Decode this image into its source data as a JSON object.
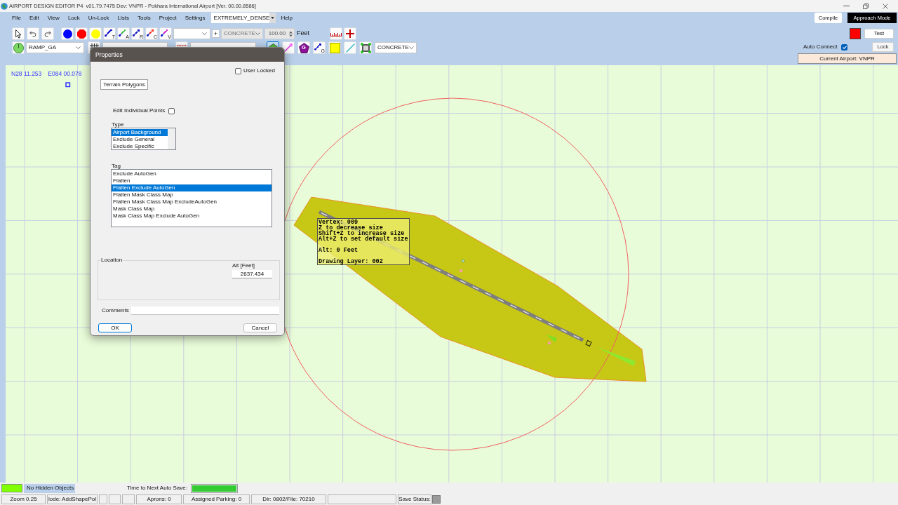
{
  "window": {
    "title": "AIRPORT DESIGN EDITOR P4  v01.79.7475 Dev: VNPR - Pokhara International Airport [Ver. 00.00.8586]"
  },
  "menu": [
    {
      "kind": "item",
      "label": "File"
    },
    {
      "kind": "item",
      "label": "Edit"
    },
    {
      "kind": "item",
      "label": "View"
    },
    {
      "kind": "item",
      "label": "Lock"
    },
    {
      "kind": "item",
      "label": "Un-Lock"
    },
    {
      "kind": "item",
      "label": "Lists"
    },
    {
      "kind": "item",
      "label": "Tools"
    },
    {
      "kind": "item",
      "label": "Project"
    },
    {
      "kind": "item",
      "label": "Settings"
    },
    {
      "kind": "select",
      "value": "EXTREMELY_DENSE"
    },
    {
      "kind": "item",
      "label": "Help"
    }
  ],
  "toolbar_rows": [
    {
      "groups": [
        [
          {
            "kind": "pointer",
            "selected": false
          },
          {
            "kind": "undo",
            "selected": false
          },
          {
            "kind": "redo",
            "selected": false
          }
        ],
        [
          {
            "kind": "dot",
            "color": "#0000ff",
            "selected": false
          },
          {
            "kind": "octagon",
            "color": "#ff0000",
            "selected": false
          },
          {
            "kind": "dot",
            "color": "#ffff00",
            "selected": false
          },
          {
            "kind": "line",
            "letter": "T",
            "color": "#1414c8",
            "selected": false
          },
          {
            "kind": "line",
            "letter": "A",
            "color": "#40c040",
            "selected": false
          },
          {
            "kind": "line",
            "letter": "R",
            "color": "#1414c8",
            "selected": false
          },
          {
            "kind": "line",
            "letter": "C",
            "color": "#ff3020",
            "selected": false
          },
          {
            "kind": "line",
            "letter": "V",
            "color": "#d030d0",
            "selected": false
          },
          {
            "kind": "select",
            "disabled": false
          },
          {
            "kind": "button",
            "label": "+"
          },
          {
            "kind": "select",
            "value": "CONCRETE",
            "disabled": true
          },
          {
            "kind": "spin",
            "value": "100.00",
            "disabled": true
          },
          {
            "kind": "label",
            "text": "Feet"
          }
        ],
        [
          {
            "kind": "ruler",
            "selected": false
          },
          {
            "kind": "cross",
            "selected": false
          }
        ]
      ]
    },
    {
      "groups": [
        [
          {
            "kind": "clock",
            "selected": false
          },
          {
            "kind": "select",
            "value": "RAMP_GA",
            "disabled": false
          }
        ],
        [
          {
            "kind": "grid",
            "selected": false
          },
          {
            "kind": "select",
            "disabled": false
          }
        ],
        [
          {
            "kind": "dots",
            "selected": false
          },
          {
            "kind": "select",
            "disabled": false
          }
        ],
        [
          {
            "kind": "house",
            "selected": true
          },
          {
            "kind": "wand",
            "selected": false
          },
          {
            "kind": "pentagon",
            "letter": "G",
            "selected": false
          },
          {
            "kind": "line",
            "letter": "G",
            "color": "#1414c8",
            "selected": false
          },
          {
            "kind": "square",
            "selected": false
          },
          {
            "kind": "diagonal",
            "selected": false
          },
          {
            "kind": "nodes",
            "selected": false
          },
          {
            "kind": "select",
            "value": "CONCRETE",
            "disabled": false
          }
        ]
      ]
    }
  ],
  "right_panel": {
    "header_buttons": [
      {
        "label": "Compile",
        "kind": "plain"
      },
      {
        "label": "Approach Mode",
        "kind": "dark"
      }
    ],
    "color_swatch": {
      "color": "#ff0000"
    },
    "test_button": "Test",
    "auto_connect": {
      "label": "Auto Connect",
      "checked": true
    },
    "lock_button": "Lock",
    "current_airport": "Current Airport: VNPR"
  },
  "canvas": {
    "coordinates": [
      "N28 11.253",
      "E084 00.078"
    ],
    "tooltip": {
      "blocks": [
        [
          "Vertex: 009",
          "Z to decrease size",
          "Shift+Z to increase size",
          "Alt+Z to set default size"
        ],
        [
          "Alt: 0 Feet"
        ],
        [
          "Drawing Layer: 002"
        ]
      ]
    }
  },
  "dialog": {
    "title": "Properties",
    "user_locked": {
      "label": "User Locked",
      "checked": false
    },
    "object_type": "Terrain Polygons",
    "edit_points": {
      "label": "Edit Individual Points",
      "checked": false
    },
    "type": {
      "label": "Type",
      "items": [
        {
          "label": "Airport Background",
          "selected": true
        },
        {
          "label": "Exclude General",
          "selected": false
        },
        {
          "label": "Exclude Specific",
          "selected": false
        }
      ]
    },
    "tag": {
      "label": "Tag",
      "items": [
        {
          "label": "Exclude AutoGen",
          "selected": false
        },
        {
          "label": "Flatten",
          "selected": false
        },
        {
          "label": "Flatten Exclude AutoGen",
          "selected": true
        },
        {
          "label": "Flatten Mask Class Map",
          "selected": false
        },
        {
          "label": "Flatten Mask Class Map ExcludeAutoGen",
          "selected": false
        },
        {
          "label": "Mask Class Map",
          "selected": false
        },
        {
          "label": "Mask Class Map Exclude AutoGen",
          "selected": false
        }
      ]
    },
    "location": {
      "legend": "Location",
      "alt_label": "Alt [Feet]",
      "alt_value": "2637.434"
    },
    "comments": {
      "label": "Comments"
    },
    "buttons": [
      {
        "label": "OK",
        "default": true
      },
      {
        "label": "Cancel",
        "default": false
      }
    ]
  },
  "status": {
    "indicator_label": "No Hidden Objects",
    "autosave": {
      "label": "Time to Next Auto Save:",
      "level": 1
    },
    "panels": [
      {
        "kind": "text",
        "text": "Zoom 0.25"
      },
      {
        "kind": "text",
        "text": "lode: AddShapePol"
      },
      {
        "kind": "blank"
      },
      {
        "kind": "blank"
      },
      {
        "kind": "blank"
      },
      {
        "kind": "text",
        "text": "Aprons: 0"
      },
      {
        "kind": "text",
        "text": "Assigned Parking: 0"
      },
      {
        "kind": "text",
        "text": "Dir: 0802/File: 70210"
      },
      {
        "kind": "blank"
      },
      {
        "kind": "save",
        "text": "Save Status:"
      }
    ]
  }
}
